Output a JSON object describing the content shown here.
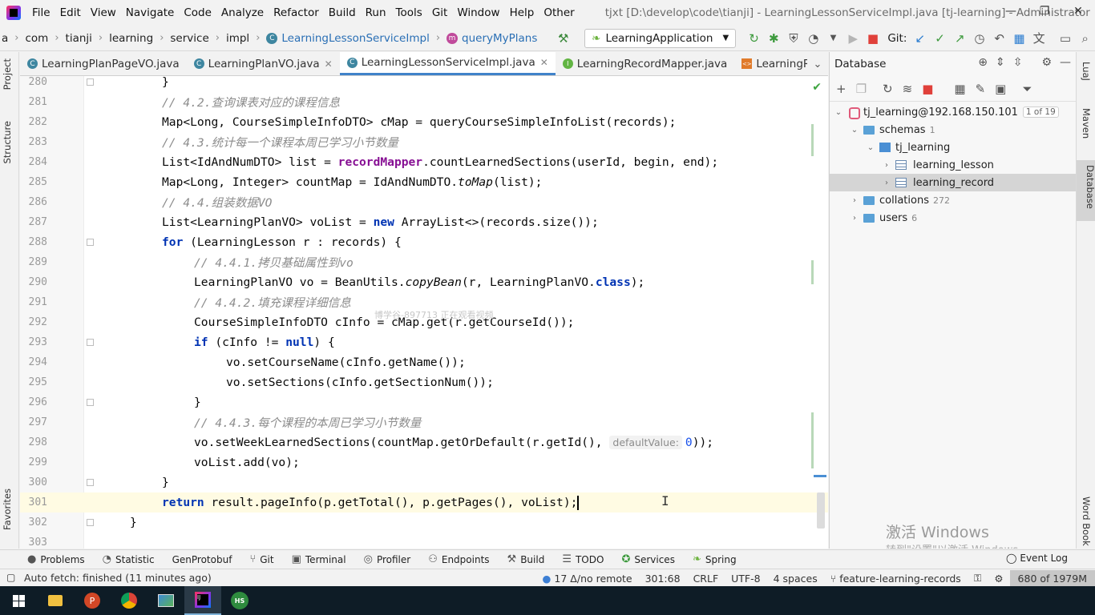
{
  "menubar": {
    "items": [
      "File",
      "Edit",
      "View",
      "Navigate",
      "Code",
      "Analyze",
      "Refactor",
      "Build",
      "Run",
      "Tools",
      "Git",
      "Window",
      "Help",
      "Other"
    ],
    "title": "tjxt [D:\\develop\\code\\tianji] - LearningLessonServiceImpl.java [tj-learning] - Administrator"
  },
  "breadcrumb": {
    "items": [
      "a",
      "com",
      "tianji",
      "learning",
      "service",
      "impl"
    ],
    "class_name": "LearningLessonServiceImpl",
    "method_name": "queryMyPlans",
    "run_config": "LearningApplication",
    "git_label": "Git:"
  },
  "left_stripe": {
    "project": "Project",
    "structure": "Structure",
    "favorites": "Favorites"
  },
  "right_stripe": {
    "luaj": "LuaJ",
    "maven": "Maven",
    "database": "Database",
    "wordbook": "Word Book"
  },
  "editor_tabs": [
    {
      "label": "LearningPlanPageVO.java",
      "kind": "class",
      "active": false
    },
    {
      "label": "LearningPlanVO.java",
      "kind": "class",
      "active": false
    },
    {
      "label": "LearningLessonServiceImpl.java",
      "kind": "class",
      "active": true
    },
    {
      "label": "LearningRecordMapper.java",
      "kind": "interface",
      "active": false
    },
    {
      "label": "LearningRecordMa",
      "kind": "xml",
      "active": false
    }
  ],
  "editor": {
    "line_numbers": [
      "280",
      "281",
      "282",
      "283",
      "284",
      "285",
      "286",
      "287",
      "288",
      "289",
      "290",
      "291",
      "292",
      "293",
      "294",
      "295",
      "296",
      "297",
      "298",
      "299",
      "300",
      "301",
      "302",
      "303"
    ],
    "lines": {
      "l280": "}",
      "l281": "// 4.2.查询课表对应的课程信息",
      "l282_a": "Map<Long, CourseSimpleInfoDTO> cMap = queryCourseSimpleInfoList(records);",
      "l283": "// 4.3.统计每一个课程本周已学习小节数量",
      "l284_a": "List<IdAndNumDTO> list = ",
      "l284_b": "recordMapper",
      "l284_c": ".countLearnedSections(userId, begin, end);",
      "l285_a": "Map<Long, Integer> countMap = IdAndNumDTO.",
      "l285_b": "toMap",
      "l285_c": "(list);",
      "l286": "// 4.4.组装数据VO",
      "l287_a": "List<LearningPlanVO> voList = ",
      "l287_b": "new",
      "l287_c": " ArrayList<>(records.size());",
      "l288_a": "for",
      "l288_b": " (LearningLesson r : records) {",
      "l289": "// 4.4.1.拷贝基础属性到vo",
      "l290_a": "LearningPlanVO vo = BeanUtils.",
      "l290_b": "copyBean",
      "l290_c": "(r, LearningPlanVO.",
      "l290_d": "class",
      "l290_e": ");",
      "l291": "// 4.4.2.填充课程详细信息",
      "l292": "CourseSimpleInfoDTO cInfo = cMap.get(r.getCourseId());",
      "l293_a": "if",
      "l293_b": " (cInfo != ",
      "l293_c": "null",
      "l293_d": ") {",
      "l294": "vo.setCourseName(cInfo.getName());",
      "l295": "vo.setSections(cInfo.getSectionNum());",
      "l296": "}",
      "l297": "// 4.4.3.每个课程的本周已学习小节数量",
      "l298_a": "vo.setWeekLearnedSections(countMap.getOrDefault(r.getId(), ",
      "l298_hint": "defaultValue:",
      "l298_num": "0",
      "l298_c": "));",
      "l299": "voList.add(vo);",
      "l300": "}",
      "l301_a": "return",
      "l301_b": " result.pageInfo(p.getTotal(), p.getPages(), voList);",
      "l302": "}",
      "l303": ""
    },
    "watermark": "博学谷-897713 正在观看视频"
  },
  "database_panel": {
    "title": "Database",
    "tree": [
      {
        "label": "tj_learning@192.168.150.101",
        "badge": "1 of 19"
      },
      {
        "label": "schemas",
        "count": "1"
      },
      {
        "label": "tj_learning"
      },
      {
        "label": "learning_lesson"
      },
      {
        "label": "learning_record"
      },
      {
        "label": "collations",
        "count": "272"
      },
      {
        "label": "users",
        "count": "6"
      }
    ],
    "activate_title": "激活 Windows",
    "activate_sub": "转到\"设置\"以激活 Windows。"
  },
  "tool_windows": [
    "Problems",
    "Statistic",
    "GenProtobuf",
    "Git",
    "Terminal",
    "Profiler",
    "Endpoints",
    "Build",
    "TODO",
    "Services",
    "Spring"
  ],
  "event_log": "Event Log",
  "status_bar": {
    "message": "Auto fetch: finished (11 minutes ago)",
    "vcs": "17 Δ/no remote",
    "position": "301:68",
    "line_sep": "CRLF",
    "encoding": "UTF-8",
    "indent": "4 spaces",
    "branch": "feature-learning-records",
    "memory": "680 of 1979M"
  },
  "colors": {
    "keyword": "#0033b3",
    "comment": "#8c8c8c",
    "field": "#871094",
    "active_tab": "#4083c9",
    "taskbar": "#0e1c26"
  }
}
